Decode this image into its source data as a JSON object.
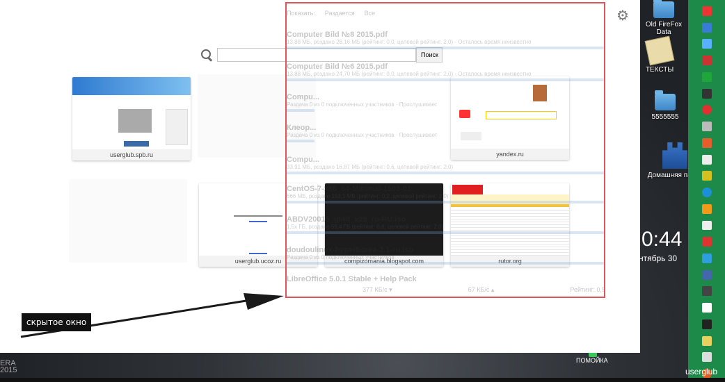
{
  "ntp": {
    "search_placeholder": "",
    "search_button": "Поиск",
    "tiles": [
      {
        "caption": "userglub.spb.ru"
      },
      {
        "caption": ""
      },
      {
        "caption": "yandex.ru"
      },
      {
        "caption": ""
      },
      {
        "caption": "userglub.ucoz.ru"
      },
      {
        "caption": "compizomania.blogspot.com"
      },
      {
        "caption": "rutor.org"
      }
    ]
  },
  "hidden_window": {
    "header": [
      "Показать:",
      "Раздается",
      "Все"
    ],
    "rows": [
      {
        "title": "Computer Bild №8 2015.pdf",
        "meta": "13,88 МБ, роздано 28,16 МБ (рейтинг: 0,0, целевой рейтинг: 2,0) · Осталось время неизвестно"
      },
      {
        "title": "Computer Bild №6 2015.pdf",
        "meta": "13,88 МБ, роздано 24,70 МБ (рейтинг: 0,0, целевой рейтинг: 2,0) · Осталось время неизвестно"
      },
      {
        "title": "Compu...",
        "meta": "Раздача 0 из 0 подключенных участников · Прослушивает"
      },
      {
        "title": "Клеор...",
        "meta": "Раздача 0 из 0 подключенных участников · Прослушивает"
      },
      {
        "title": "Compu...",
        "meta": "33,91 МБ, роздано 16,87 МБ (рейтинг: 0,6, целевой рейтинг: 2,0)"
      },
      {
        "title": "CentOS-7-x86_64-Minimal-1503-01",
        "meta": "666 МБ, роздано 153,1 МБ (рейтинг: 0,2, целевой рейтинг: 2,0)"
      },
      {
        "title": "ABDV20015_gt4d_x29_ru-RU.iso",
        "meta": "1,5х ГБ, роздано 59,4 ГБ (рейтинг: 0,6, целевой рейтинг: 2,0)"
      },
      {
        "title": "doudoulinux-hyperborea-2.1-ru.iso",
        "meta": "Раздача 0 из 0 подключенных участников"
      },
      {
        "title": "LibreOffice 5.0.1 Stable + Help Pack",
        "meta": ""
      }
    ],
    "footer_left": "377 КБ/с ▾",
    "footer_mid": "67 КБ/с ▴",
    "footer_right": "Рейтинг: 0,5"
  },
  "annotation": "скрытое окно",
  "desktop": {
    "icons": [
      {
        "label": "Old FireFox Data"
      },
      {
        "label": "ТЕКСТЫ"
      },
      {
        "label": "5555555"
      },
      {
        "label": "Домашняя папка"
      },
      {
        "label": "ПОМОЙКА"
      }
    ],
    "clock": "0:44",
    "date": "нтябрь 30",
    "user": "userglub",
    "corner": "ERA\n2015"
  },
  "colors": {
    "launcher": "#1e8a4a",
    "frame": "#e05558"
  }
}
